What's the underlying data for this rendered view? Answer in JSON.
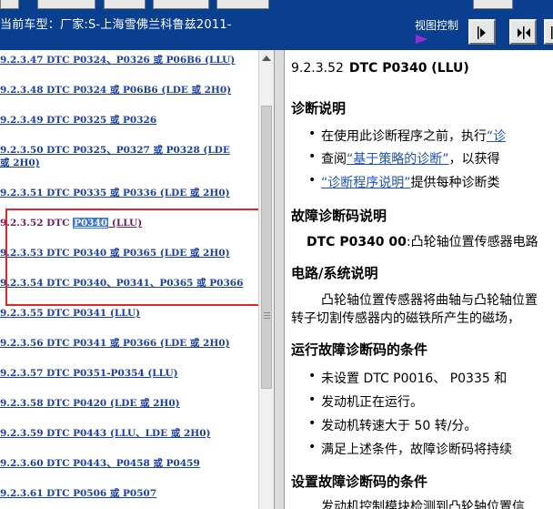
{
  "header": {
    "vehicle_label": "当前车型：厂家:S-上海雪佛兰科鲁兹2011-",
    "view_control_label": "视图控制",
    "nav_buttons": [
      "forward-button",
      "fit-button",
      "next-button"
    ]
  },
  "toc": [
    {
      "label": "9.2.3.47 DTC P0324、P0326 或 P06B6 (LLU)"
    },
    {
      "label": "9.2.3.48 DTC P0324 或 P06B6 (LDE 或 2H0)"
    },
    {
      "label": "9.2.3.49 DTC P0325 或 P0326"
    },
    {
      "label_line1": "9.2.3.50 DTC P0325、P0327 或 P0328 (LDE",
      "label_line2": "或 2H0)"
    },
    {
      "label": "9.2.3.51 DTC P0335 或 P0336 (LDE 或 2H0)"
    },
    {
      "prefix": "9.2.3.52 DTC ",
      "highlight": "P0340",
      "suffix": " (LLU)",
      "active": true
    },
    {
      "label": "9.2.3.53 DTC P0340 或 P0365 (LDE 或 2H0)"
    },
    {
      "label": "9.2.3.54 DTC P0340、P0341、P0365 或 P0366"
    },
    {
      "label": "9.2.3.55 DTC P0341 (LLU)"
    },
    {
      "label": "9.2.3.56 DTC P0341 或 P0366 (LDE 或 2H0)"
    },
    {
      "label": "9.2.3.57 DTC P0351-P0354 (LLU)"
    },
    {
      "label": "9.2.3.58 DTC P0420 (LDE 或 2H0)"
    },
    {
      "label": "9.2.3.59 DTC P0443 (LLU、LDE 或 2H0)"
    },
    {
      "label": "9.2.3.60 DTC P0443、P0458 或 P0459"
    },
    {
      "label": "9.2.3.61 DTC P0506 或 P0507"
    }
  ],
  "doc": {
    "title_num": "9.2.3.52",
    "title_code": "DTC P0340 (LLU)",
    "sections": {
      "diag": "诊断说明",
      "dtc_desc": "故障诊断码说明",
      "circuit": "电路/系统说明",
      "run_cond": "运行故障诊断码的条件",
      "set_cond": "设置故障诊断码的条件"
    },
    "diag_b1_text": "在使用此诊断程序之前，执行",
    "diag_b1_link": "“诊",
    "diag_b2_text": "查阅",
    "diag_b2_link": "“基于策略的诊断”",
    "diag_b2_tail": "，以获得",
    "diag_b3_link": "“诊断程序说明”",
    "diag_b3_tail": "提供每种诊断类",
    "dtc_code": "DTC P0340 00",
    "dtc_text": ":凸轮轴位置传感器电路",
    "circuit_line1": "凸轮轴位置传感器将曲轴与凸轮轴位置",
    "circuit_line2": "转子切割传感器内的磁铁所产生的磁场，",
    "run_b1": "未设置  DTC P0016、 P0335 和",
    "run_b2": "发动机正在运行。",
    "run_b3": "发动机转速大于  50   转/分。",
    "run_b4": "满足上述条件，故障诊断码将持续",
    "set_line1": "发动机控制模块检测到凸轮轴位置信"
  }
}
